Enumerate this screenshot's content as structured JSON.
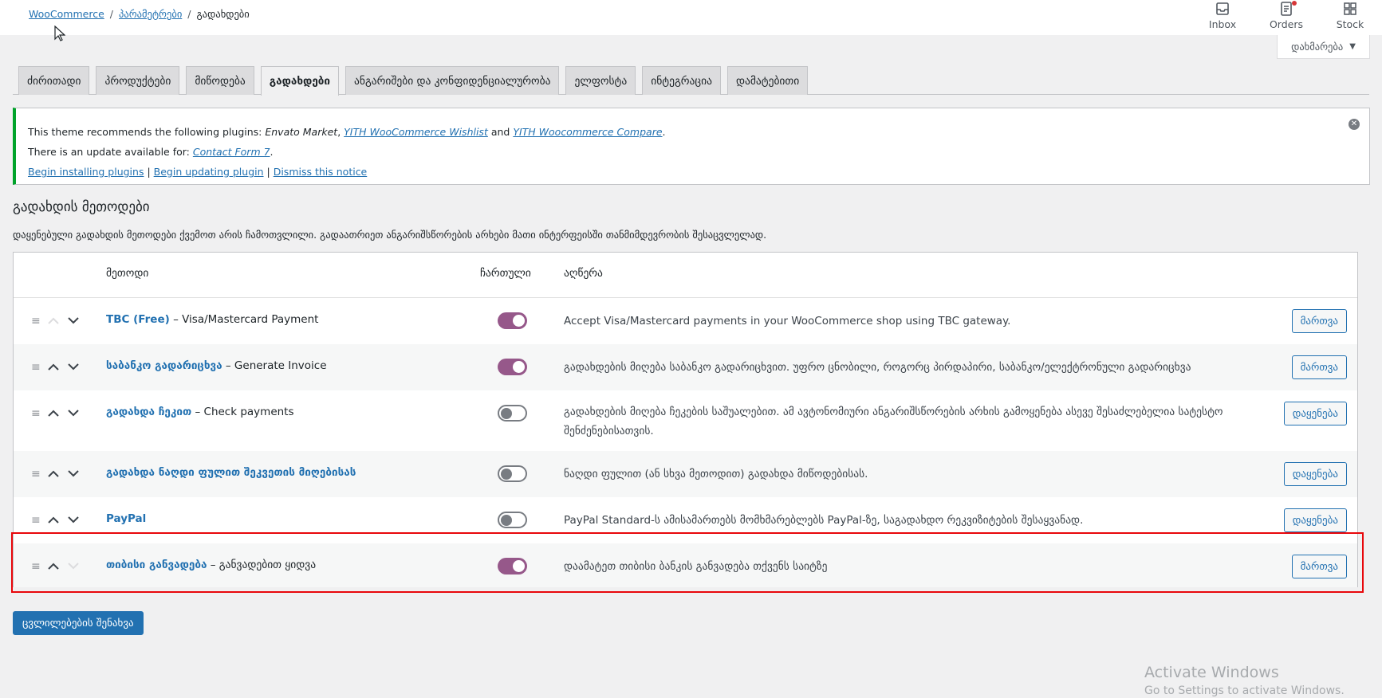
{
  "breadcrumb": {
    "root": "WooCommerce",
    "parent": "პარამეტრები",
    "current": "გადახდები",
    "separator": "/"
  },
  "header_actions": [
    {
      "label": "Inbox",
      "icon": "inbox-icon"
    },
    {
      "label": "Orders",
      "icon": "orders-icon",
      "has_notification": true
    },
    {
      "label": "Stock",
      "icon": "stock-icon"
    }
  ],
  "help_button": {
    "label": "დახმარება",
    "caret": "▼"
  },
  "tabs": [
    {
      "label": "ძირითადი"
    },
    {
      "label": "პროდუქტები"
    },
    {
      "label": "მიწოდება"
    },
    {
      "label": "გადახდები",
      "active": true
    },
    {
      "label": "ანგარიშები და კონფიდენციალურობა"
    },
    {
      "label": "ელფოსტა"
    },
    {
      "label": "ინტეგრაცია"
    },
    {
      "label": "დამატებითი"
    }
  ],
  "notice": {
    "line1_prefix": "This theme recommends the following plugins: ",
    "line1_plugin1": "Envato Market",
    "line1_sep1": ", ",
    "line1_plugin2": "YITH WooCommerce Wishlist",
    "line1_and": " and ",
    "line1_plugin3": "YITH Woocommerce Compare",
    "line1_end": ".",
    "line2_prefix": "There is an update available for: ",
    "line2_plugin": "Contact Form 7",
    "line2_end": ".",
    "link_install": "Begin installing plugins",
    "link_update": "Begin updating plugin",
    "link_dismiss": "Dismiss this notice",
    "link_sep": " | ",
    "close_glyph": "✕",
    "accent_color": "#00a32a"
  },
  "section": {
    "title": "გადახდის მეთოდები",
    "description": "დაყენებული გადახდის მეთოდები ქვემოთ არის ჩამოთვლილი. გადაათრიეთ ანგარიშსწორების არხები მათი ინტერფეისში თანმიმდევრობის შესაცვლელად."
  },
  "table": {
    "headers": {
      "method": "მეთოდი",
      "enabled": "ჩართული",
      "description": "აღწერა"
    },
    "rows": [
      {
        "name": "TBC (Free)",
        "suffix": " – Visa/Mastercard Payment",
        "enabled": true,
        "description": "Accept Visa/Mastercard payments in your WooCommerce shop using TBC gateway.",
        "action": "მართვა",
        "up_enabled": false,
        "down_enabled": true
      },
      {
        "name": "საბანკო გადარიცხვა",
        "suffix": " – Generate Invoice",
        "enabled": true,
        "description": "გადახდების მიღება საბანკო გადარიცხვით. უფრო ცნობილი, როგორც პირდაპირი, საბანკო/ელექტრონული გადარიცხვა",
        "action": "მართვა",
        "up_enabled": true,
        "down_enabled": true
      },
      {
        "name": "გადახდა ჩეკით",
        "suffix": " – Check payments",
        "enabled": false,
        "description": "გადახდების მიღება ჩეკების საშუალებით. ამ ავტონომიური ანგარიშსწორების არხის გამოყენება ასევე შესაძლებელია სატესტო შენძენებისათვის.",
        "action": "დაყენება",
        "up_enabled": true,
        "down_enabled": true
      },
      {
        "name": "გადახდა ნაღდი ფულით შეკვეთის მიღებისას",
        "suffix": "",
        "enabled": false,
        "description": "ნაღდი ფულით (ან სხვა მეთოდით) გადახდა მიწოდებისას.",
        "action": "დაყენება",
        "up_enabled": true,
        "down_enabled": true
      },
      {
        "name": "PayPal",
        "suffix": "",
        "enabled": false,
        "description": "PayPal Standard-ს ამისამართებს მომხმარებლებს PayPal-ზე, საგადახდო რეკვიზიტების შესაყვანად.",
        "action": "დაყენება",
        "up_enabled": true,
        "down_enabled": true
      },
      {
        "name": "თიბისი განვადება",
        "suffix": " – განვადებით ყიდვა",
        "enabled": true,
        "description": "დაამატეთ თიბისი ბანკის განვადება თქვენს საიტზე",
        "action": "მართვა",
        "up_enabled": true,
        "down_enabled": false,
        "highlighted": true
      }
    ]
  },
  "save_button": "ცვლილებების შენახვა",
  "watermark": {
    "title": "Activate Windows",
    "subtitle": "Go to Settings to activate Windows."
  },
  "colors": {
    "toggle_on": "#96588a",
    "primary": "#2271b1",
    "highlight_border": "#e8070b"
  }
}
